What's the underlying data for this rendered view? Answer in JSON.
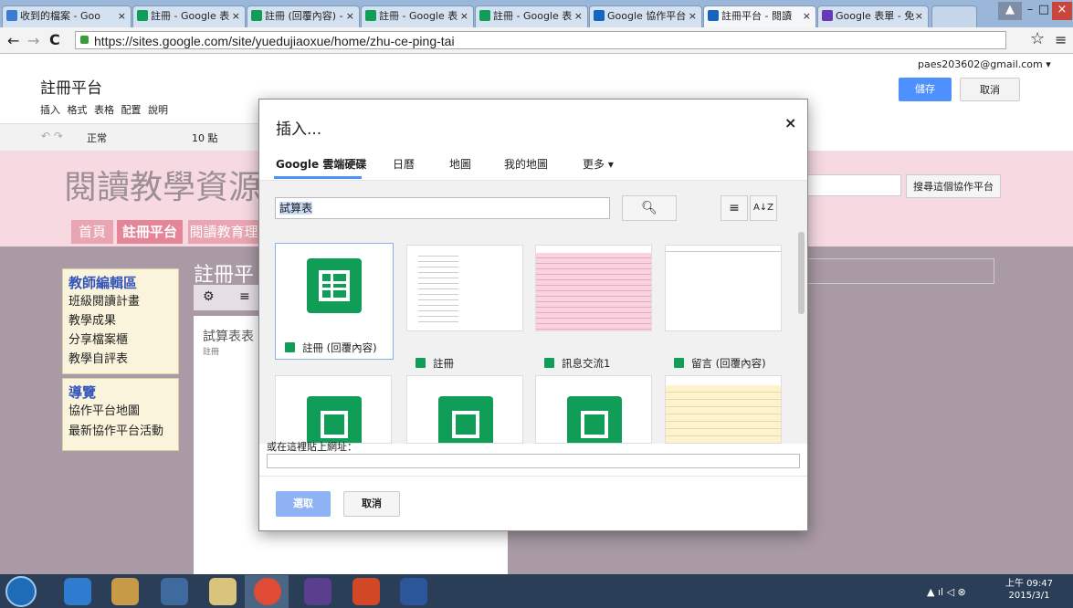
{
  "browser": {
    "tabs": [
      {
        "label": "收到的檔案 - Goo"
      },
      {
        "label": "註冊 - Google 表"
      },
      {
        "label": "註冊 (回覆內容) -"
      },
      {
        "label": "註冊 - Google 表"
      },
      {
        "label": "註冊 - Google 表"
      },
      {
        "label": "Google 協作平台"
      },
      {
        "label": "註冊平台 - 閱讀"
      },
      {
        "label": "Google 表單 - 免"
      }
    ],
    "url": "https://sites.google.com/site/yuedujiaoxue/home/zhu-ce-ping-tai",
    "back": "←",
    "forward": "→",
    "reload": "C",
    "star": "☆",
    "menu": "≡",
    "win_min": "–",
    "win_max": "□",
    "win_close": "×",
    "tab_close": "×"
  },
  "site": {
    "page_name": "註冊平台",
    "account": "paes203602@gmail.com ▾",
    "save_button": "儲存",
    "cancel_button": "取消",
    "menu": [
      "插入",
      "格式",
      "表格",
      "配置",
      "說明"
    ],
    "toolbar": {
      "style": "正常",
      "size": "10 點"
    },
    "site_title": "閱讀教學資源",
    "search_button": "搜尋這個協作平台",
    "nav_tabs": [
      "首頁",
      "註冊平台",
      "閱讀教育理"
    ],
    "content_title": "註冊平",
    "gadget_title": "試算表表",
    "gadget_sub": "註冊",
    "sidebar": {
      "section1_title": "教師編輯區",
      "section1_items": [
        "班級閱讀計畫",
        "教學成果",
        "分享檔案櫃",
        "教學自評表"
      ],
      "section2_title": "導覽",
      "section2_items": [
        "協作平台地圖",
        "最新協作平台活動"
      ]
    }
  },
  "dialog": {
    "title": "插入...",
    "close": "×",
    "tabs": [
      "Google 雲端硬碟",
      "日曆",
      "地圖",
      "我的地圖",
      "更多 ▾"
    ],
    "search_value": "試算表",
    "url_label": "或在這裡貼上網址：",
    "select_button": "選取",
    "cancel_button": "取消",
    "files": [
      {
        "label": "註冊 (回覆內容)"
      },
      {
        "label": "註冊"
      },
      {
        "label": "訊息交流1"
      },
      {
        "label": "留言 (回覆內容)"
      }
    ]
  },
  "taskbar": {
    "time": "上午 09:47",
    "date": "2015/3/1"
  },
  "colors": {
    "pink_band": "#f6d9e1",
    "nav_tab": "#e88a9a",
    "sheet_green": "#0f9d58",
    "select_blue": "#4d90fe"
  }
}
